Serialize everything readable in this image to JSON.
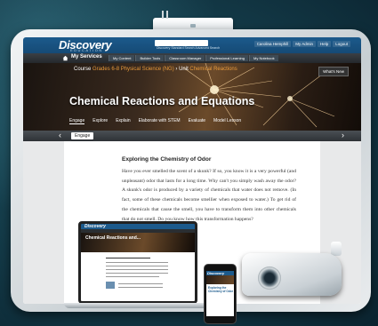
{
  "topbar": {
    "logo": "Discovery",
    "logo_sub": "EDUCATION",
    "top_links": "Discovery Standard Search    Advanced Search",
    "nav": [
      "Carolina Hemphill",
      "My Admin",
      "Help",
      "Logout"
    ]
  },
  "navbar": {
    "my_services": "My Services",
    "menu": [
      "My Content",
      "Builder Tools",
      "Classroom Manager",
      "Professional Learning",
      "My Notebook"
    ]
  },
  "hero": {
    "breadcrumb_course_label": "Course",
    "breadcrumb_course": "Grades 6-8 Physical Science (NG)",
    "breadcrumb_sep": "›",
    "breadcrumb_unit_label": "Unit",
    "breadcrumb_unit": "Chemical Reactions",
    "whats_new": "What's New",
    "title": "Chemical Reactions and Equations",
    "tabs": [
      "Engage",
      "Explore",
      "Explain",
      "Elaborate with STEM",
      "Evaluate",
      "Model Lesson"
    ]
  },
  "subbar": {
    "prev": "‹",
    "next": "›",
    "active_pill": "Engage"
  },
  "article": {
    "title": "Exploring the Chemistry of Odor",
    "body": "Have you ever smelled the scent of a skunk? If so, you know it is a very powerful (and unpleasant) odor that lasts for a long time. Why can't you simply wash away the odor? A skunk's odor is produced by a variety of chemicals that water does not remove. (In fact, some of these chemicals become smellier when exposed to water.) To get rid of the chemicals that cause the smell, you have to transform them into other chemicals that do not smell. Do you know how this transformation happens?",
    "body2": "about the nature of reactive ...ay might interact with other"
  },
  "laptop": {
    "logo": "Discovery",
    "title": "Chemical Reactions and..."
  },
  "phone": {
    "logo": "Discovery",
    "title": "Exploring the Chemistry of Odor"
  },
  "colors": {
    "brand_blue": "#1c5a8c",
    "accent_orange": "#e89a3c"
  }
}
